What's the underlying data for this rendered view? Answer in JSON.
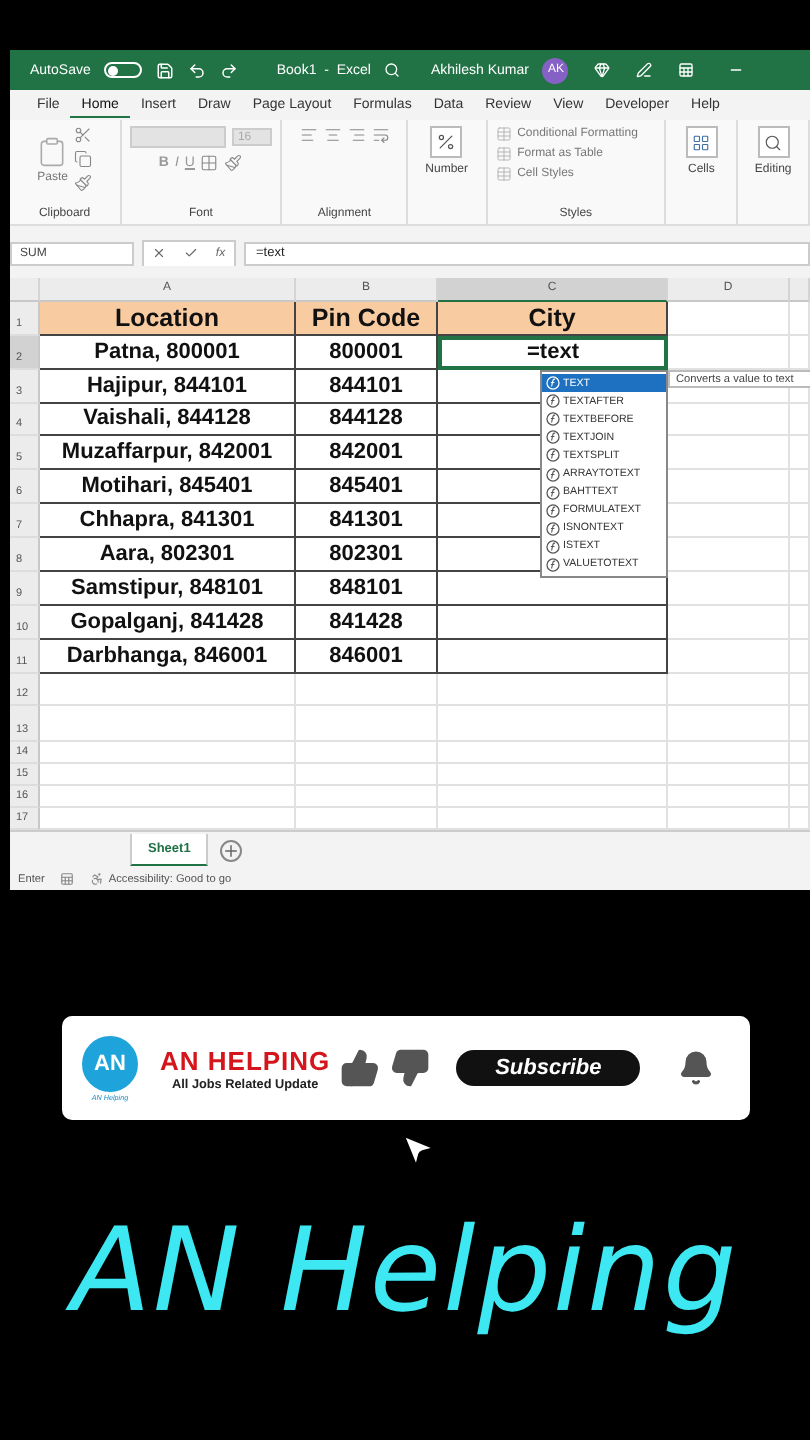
{
  "title_bar": {
    "autosave_label": "AutoSave",
    "autosave_on": false,
    "document_title": "Book1  -  Excel",
    "user_name": "Akhilesh Kumar",
    "user_initials": "AK"
  },
  "ribbon_tabs": [
    {
      "label": "File",
      "selected": false
    },
    {
      "label": "Home",
      "selected": true
    },
    {
      "label": "Insert",
      "selected": false
    },
    {
      "label": "Draw",
      "selected": false
    },
    {
      "label": "Page Layout",
      "selected": false
    },
    {
      "label": "Formulas",
      "selected": false
    },
    {
      "label": "Data",
      "selected": false
    },
    {
      "label": "Review",
      "selected": false
    },
    {
      "label": "View",
      "selected": false
    },
    {
      "label": "Developer",
      "selected": false
    },
    {
      "label": "Help",
      "selected": false
    }
  ],
  "ribbon_groups": [
    {
      "kind": "clipboard",
      "name": "Clipboard",
      "label": "Paste"
    },
    {
      "kind": "font",
      "name": "Font",
      "font_size": "16",
      "bold": "B",
      "italic": "I",
      "underline": "U"
    },
    {
      "kind": "alignment",
      "name": "Alignment"
    },
    {
      "kind": "number",
      "label": "Number"
    },
    {
      "kind": "styles",
      "name": "Styles",
      "items": [
        "Conditional Formatting",
        "Format as Table",
        "Cell Styles"
      ]
    },
    {
      "kind": "cells",
      "label": "Cells"
    },
    {
      "kind": "editing",
      "label": "Editing"
    }
  ],
  "formula_bar": {
    "name_box": "SUM",
    "fx": "fx",
    "formula": "=text"
  },
  "columns": [
    {
      "label": "A",
      "selected": false
    },
    {
      "label": "B",
      "selected": false
    },
    {
      "label": "C",
      "selected": true
    },
    {
      "label": "D",
      "selected": false
    }
  ],
  "rows": [
    {
      "number": "1",
      "kind": "header",
      "selected": false,
      "location": "Location",
      "pin": "Pin Code",
      "city": "City"
    },
    {
      "number": "2",
      "kind": "data",
      "selected": true,
      "location": "Patna, 800001",
      "pin": "800001",
      "city": "=text",
      "editing": true
    },
    {
      "number": "3",
      "kind": "data",
      "selected": false,
      "location": "Hajipur, 844101",
      "pin": "844101"
    },
    {
      "number": "4",
      "kind": "data",
      "selected": false,
      "location": "Vaishali, 844128",
      "pin": "844128"
    },
    {
      "number": "5",
      "kind": "data",
      "selected": false,
      "location": "Muzaffarpur, 842001",
      "pin": "842001"
    },
    {
      "number": "6",
      "kind": "data",
      "selected": false,
      "location": "Motihari, 845401",
      "pin": "845401"
    },
    {
      "number": "7",
      "kind": "data",
      "selected": false,
      "location": "Chhapra, 841301",
      "pin": "841301"
    },
    {
      "number": "8",
      "kind": "data",
      "selected": false,
      "location": "Aara, 802301",
      "pin": "802301"
    },
    {
      "number": "9",
      "kind": "data",
      "selected": false,
      "location": "Samstipur, 848101",
      "pin": "848101"
    },
    {
      "number": "10",
      "kind": "data",
      "selected": false,
      "location": "Gopalganj, 841428",
      "pin": "841428"
    },
    {
      "number": "11",
      "kind": "data",
      "selected": false,
      "location": "Darbhanga, 846001",
      "pin": "846001"
    },
    {
      "number": "12",
      "kind": "empty",
      "selected": false
    },
    {
      "number": "13",
      "kind": "empty",
      "selected": false
    },
    {
      "number": "14",
      "kind": "empty",
      "selected": false
    },
    {
      "number": "15",
      "kind": "empty",
      "selected": false
    },
    {
      "number": "16",
      "kind": "empty",
      "selected": false
    },
    {
      "number": "17",
      "kind": "empty",
      "selected": false
    }
  ],
  "autocomplete": {
    "items": [
      {
        "label": "TEXT",
        "selected": true
      },
      {
        "label": "TEXTAFTER",
        "selected": false
      },
      {
        "label": "TEXTBEFORE",
        "selected": false
      },
      {
        "label": "TEXTJOIN",
        "selected": false
      },
      {
        "label": "TEXTSPLIT",
        "selected": false
      },
      {
        "label": "ARRAYTOTEXT",
        "selected": false
      },
      {
        "label": "BAHTTEXT",
        "selected": false
      },
      {
        "label": "FORMULATEXT",
        "selected": false
      },
      {
        "label": "ISNONTEXT",
        "selected": false
      },
      {
        "label": "ISTEXT",
        "selected": false
      },
      {
        "label": "VALUETOTEXT",
        "selected": false
      }
    ],
    "tooltip": "Converts a value to text"
  },
  "sheet_tabs": [
    {
      "label": "Sheet1",
      "selected": true
    }
  ],
  "status_bar": {
    "mode": "Enter",
    "accessibility": "Accessibility: Good to go"
  },
  "banner": {
    "logo_initials": "AN",
    "logo_caption": "AN Helping",
    "channel_name": "AN HELPING",
    "tagline": "All Jobs Related Update",
    "subscribe": "Subscribe"
  },
  "caption": "AN Helping"
}
